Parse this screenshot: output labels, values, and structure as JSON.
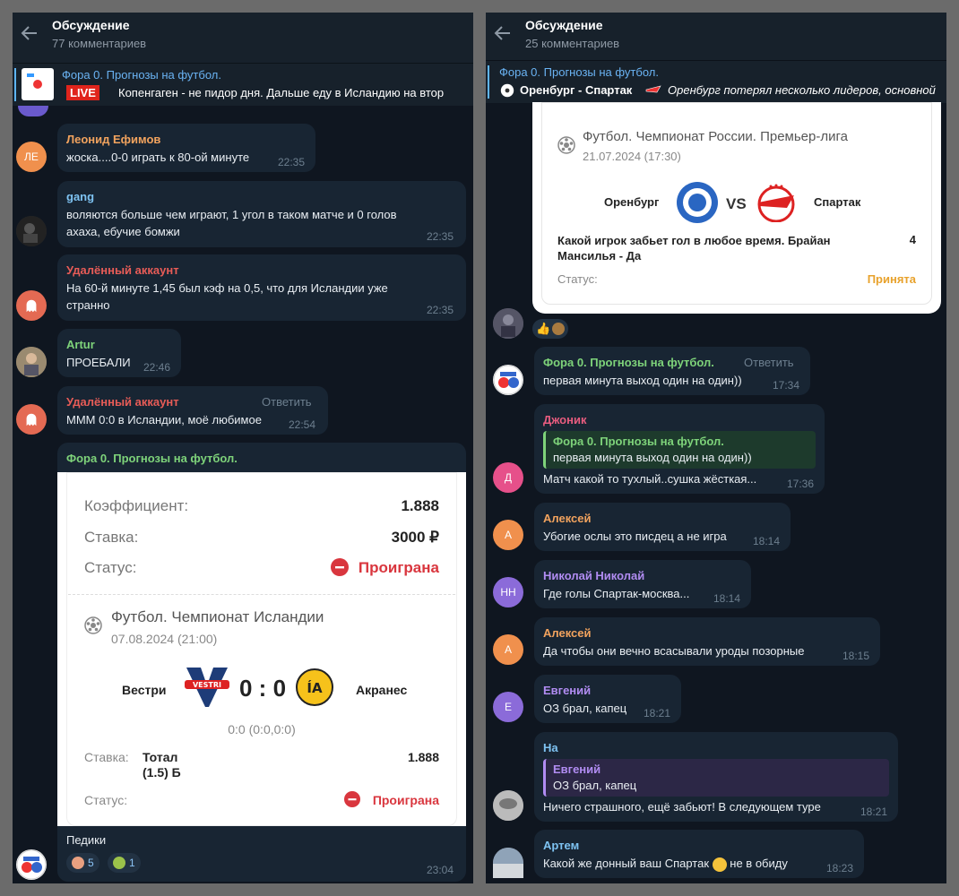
{
  "left": {
    "header": {
      "title": "Обсуждение",
      "subtitle": "77 комментариев"
    },
    "pinned": {
      "title": "Фора 0. Прогнозы на футбол.",
      "live": "LIVE",
      "text": "Копенгаген -  не пидор дня.  Дальше еду в Исландию на втор"
    },
    "messages": [
      {
        "initials": "ЛЕ",
        "author": "Леонид Ефимов",
        "text": "жоска....0-0 играть к 80-ой минуте",
        "time": "22:35"
      },
      {
        "author": "gang",
        "text": "воляются больше чем играют, 1 угол в таком матче и 0 голов ахаха, ебучие бомжи",
        "time": "22:35"
      },
      {
        "author": "Удалённый аккаунт",
        "text": "На 60-й минуте 1,45 был кэф на 0,5, что для Исландии уже странно",
        "time": "22:35"
      },
      {
        "author": "Artur",
        "text": "ПРОЕБАЛИ",
        "time": "22:46"
      },
      {
        "author": "Удалённый аккаунт",
        "reply": "Ответить",
        "text": "МММ 0:0 в Исландии, моё любимое",
        "time": "22:54"
      }
    ],
    "bet": {
      "channel": "Фора 0. Прогнозы на футбол.",
      "coef_label": "Коэффициент:",
      "coef": "1.888",
      "stake_label": "Ставка:",
      "stake": "3000 ₽",
      "status_label": "Статус:",
      "status": "Проиграна",
      "league": "Футбол. Чемпионат Исландии",
      "date": "07.08.2024 (21:00)",
      "home": "Вестри",
      "score": "0 : 0",
      "away": "Акранес",
      "home_badge": "VESTRI",
      "away_badge": "ÍA",
      "half": "0:0 (0:0,0:0)",
      "bet_label": "Ставка:",
      "bet_value": "Тотал (1.5) Б",
      "bet_coef": "1.888",
      "status2_label": "Статус:",
      "status2": "Проиграна",
      "comment": "Педики",
      "react1": "5",
      "react2": "1",
      "time": "23:04"
    }
  },
  "right": {
    "header": {
      "title": "Обсуждение",
      "subtitle": "25 комментариев"
    },
    "pinned": {
      "title": "Фора 0. Прогнозы на футбол.",
      "match": "Оренбург - Спартак",
      "text": "Оренбург потерял несколько лидеров, основной"
    },
    "card": {
      "league": "Футбол. Чемпионат России. Премьер-лига",
      "date": "21.07.2024 (17:30)",
      "home": "Оренбург",
      "vs": "VS",
      "away": "Спартак",
      "bet_text": "Какой игрок забьет гол в любое время. Брайан Мансилья - Да",
      "bet_coef": "4",
      "status_label": "Статус:",
      "status": "Принята"
    },
    "messages": [
      {
        "author": "Фора 0. Прогнозы на футбол.",
        "reply": "Ответить",
        "text": "первая минута выход один на один))",
        "time": "17:34"
      },
      {
        "initials": "Д",
        "author": "Джоник",
        "quote_author": "Фора 0. Прогнозы на футбол.",
        "quote_text": "первая минута выход один на один))",
        "text": "Матч какой то тухлый..сушка жёсткая...",
        "time": "17:36"
      },
      {
        "initials": "А",
        "author": "Алексей",
        "text": "Убогие ослы это писдец а не игра",
        "time": "18:14"
      },
      {
        "initials": "НН",
        "author": "Николай Николай",
        "text": "Где голы Спартак-москва...",
        "time": "18:14"
      },
      {
        "initials": "А",
        "author": "Алексей",
        "text": "Да чтобы они вечно всасывали уроды позорные",
        "time": "18:15"
      },
      {
        "initials": "Е",
        "author": "Евгений",
        "text": "ОЗ брал, капец",
        "time": "18:21"
      },
      {
        "author": "На",
        "quote_author": "Евгений",
        "quote_text": "ОЗ брал, капец",
        "text": "Ничего страшного, ещё забьют! В следующем туре",
        "time": "18:21"
      },
      {
        "author": "Артем",
        "text": "Какой же донный ваш Спартак",
        "text2": "не в обиду",
        "time": "18:23"
      }
    ]
  },
  "colors": {
    "bg": "#0f1620",
    "bubble": "#182533",
    "accent": "#6ab3f3",
    "lost": "#d9363e",
    "accepted": "#e8a22c"
  }
}
